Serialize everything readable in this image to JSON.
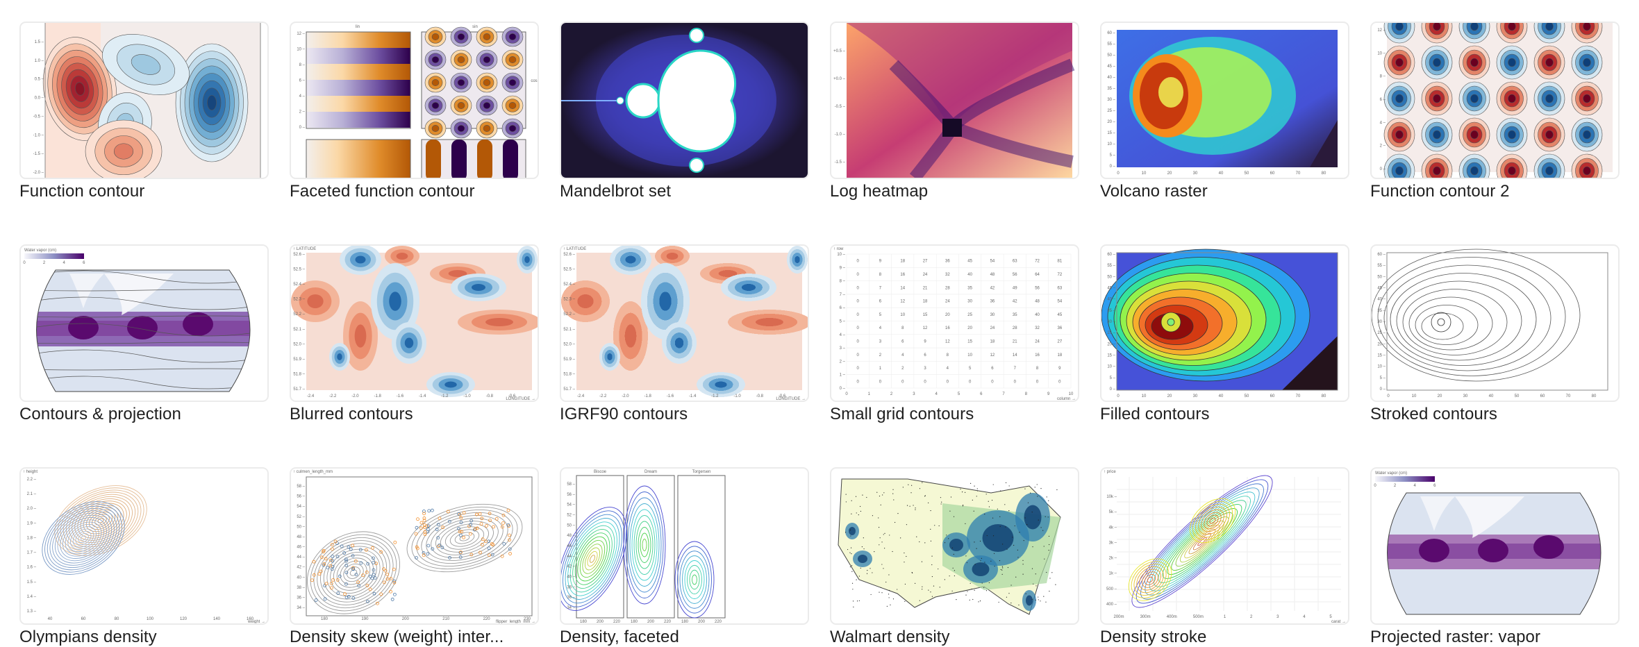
{
  "gallery": {
    "items": [
      {
        "title": "Function contour",
        "thumb": "function-contour",
        "axis": {
          "y": [
            "1.5",
            "1.0",
            "0.5",
            "0.0",
            "-0.5",
            "-1.0",
            "-1.5",
            "-2.0"
          ]
        }
      },
      {
        "title": "Faceted function contour",
        "thumb": "faceted-function-contour",
        "facets": {
          "columns": [
            "lin",
            "sin"
          ],
          "rows": [
            "cos"
          ]
        },
        "axis": {
          "y": [
            "12",
            "10",
            "8",
            "6",
            "4",
            "2",
            "0"
          ]
        }
      },
      {
        "title": "Mandelbrot set",
        "thumb": "mandelbrot"
      },
      {
        "title": "Log heatmap",
        "thumb": "log-heatmap",
        "axis": {
          "y": [
            "+0.5",
            "+0.0",
            "-0.5",
            "-1.0",
            "-1.5"
          ]
        }
      },
      {
        "title": "Volcano raster",
        "thumb": "volcano-raster",
        "axis": {
          "x": [
            "0",
            "10",
            "20",
            "30",
            "40",
            "50",
            "60",
            "70",
            "80"
          ],
          "y": [
            "60",
            "55",
            "50",
            "45",
            "40",
            "35",
            "30",
            "25",
            "20",
            "15",
            "10",
            "5",
            "0"
          ]
        }
      },
      {
        "title": "Function contour 2",
        "thumb": "function-contour-2",
        "axis": {
          "y": [
            "12",
            "10",
            "8",
            "6",
            "4",
            "2",
            "0"
          ]
        }
      },
      {
        "title": "Contours & projection",
        "thumb": "contours-projection",
        "legend": {
          "label": "Water vapor (cm)",
          "ticks": [
            "0",
            "2",
            "4",
            "6"
          ]
        }
      },
      {
        "title": "Blurred contours",
        "thumb": "blurred-contours",
        "axis": {
          "xlabel": "LONGITUDE →",
          "ylabel": "↑ LATITUDE",
          "x": [
            "-2.4",
            "-2.2",
            "-2.0",
            "-1.8",
            "-1.6",
            "-1.4",
            "-1.2",
            "-1.0",
            "-0.8",
            "-0.6"
          ],
          "y": [
            "52.6",
            "52.5",
            "52.4",
            "52.3",
            "52.2",
            "52.1",
            "52.0",
            "51.9",
            "51.8",
            "51.7"
          ]
        }
      },
      {
        "title": "IGRF90 contours",
        "thumb": "igrf90-contours",
        "axis": {
          "xlabel": "LONGITUDE →",
          "ylabel": "↑ LATITUDE",
          "x": [
            "-2.4",
            "-2.2",
            "-2.0",
            "-1.8",
            "-1.6",
            "-1.4",
            "-1.2",
            "-1.0",
            "-0.8",
            "-0.6"
          ],
          "y": [
            "52.6",
            "52.5",
            "52.4",
            "52.3",
            "52.2",
            "52.1",
            "52.0",
            "51.9",
            "51.8",
            "51.7"
          ]
        }
      },
      {
        "title": "Small grid contours",
        "thumb": "small-grid-contours",
        "axis": {
          "xlabel": "column →",
          "ylabel": "↑ row",
          "x": [
            "0",
            "1",
            "2",
            "3",
            "4",
            "5",
            "6",
            "7",
            "8",
            "9",
            "10"
          ],
          "y": [
            "0",
            "1",
            "2",
            "3",
            "4",
            "5",
            "6",
            "7",
            "8",
            "9",
            "10"
          ]
        },
        "grid_values": [
          [
            0,
            9,
            18,
            27,
            36,
            45,
            54,
            63,
            72,
            81
          ],
          [
            0,
            8,
            16,
            24,
            32,
            40,
            48,
            56,
            64,
            72
          ],
          [
            0,
            7,
            14,
            21,
            28,
            35,
            42,
            49,
            56,
            63
          ],
          [
            0,
            6,
            12,
            18,
            24,
            30,
            36,
            42,
            48,
            54
          ],
          [
            0,
            5,
            10,
            15,
            20,
            25,
            30,
            35,
            40,
            45
          ],
          [
            0,
            4,
            8,
            12,
            16,
            20,
            24,
            28,
            32,
            36
          ],
          [
            0,
            3,
            6,
            9,
            12,
            15,
            18,
            21,
            24,
            27
          ],
          [
            0,
            2,
            4,
            6,
            8,
            10,
            12,
            14,
            16,
            18
          ],
          [
            0,
            1,
            2,
            3,
            4,
            5,
            6,
            7,
            8,
            9
          ],
          [
            0,
            0,
            0,
            0,
            0,
            0,
            0,
            0,
            0,
            0
          ]
        ]
      },
      {
        "title": "Filled contours",
        "thumb": "filled-contours",
        "axis": {
          "x": [
            "0",
            "10",
            "20",
            "30",
            "40",
            "50",
            "60",
            "70",
            "80"
          ],
          "y": [
            "60",
            "55",
            "50",
            "45",
            "40",
            "35",
            "30",
            "25",
            "20",
            "15",
            "10",
            "5",
            "0"
          ]
        }
      },
      {
        "title": "Stroked contours",
        "thumb": "stroked-contours",
        "axis": {
          "x": [
            "0",
            "10",
            "20",
            "30",
            "40",
            "50",
            "60",
            "70",
            "80"
          ],
          "y": [
            "60",
            "55",
            "50",
            "45",
            "40",
            "35",
            "30",
            "25",
            "20",
            "15",
            "10",
            "5",
            "0"
          ]
        }
      },
      {
        "title": "Olympians density",
        "thumb": "olympians-density",
        "axis": {
          "xlabel": "weight →",
          "ylabel": "↑ height",
          "x": [
            "40",
            "60",
            "80",
            "100",
            "120",
            "140",
            "160"
          ],
          "y": [
            "2.2",
            "2.1",
            "2.0",
            "1.9",
            "1.8",
            "1.7",
            "1.6",
            "1.5",
            "1.4",
            "1.3"
          ]
        }
      },
      {
        "title": "Density skew (weight) inter...",
        "thumb": "density-skew",
        "axis": {
          "xlabel": "flipper_length_mm →",
          "ylabel": "↑ culmen_length_mm",
          "x": [
            "180",
            "190",
            "200",
            "210",
            "220",
            "230"
          ],
          "y": [
            "58",
            "56",
            "54",
            "52",
            "50",
            "48",
            "46",
            "44",
            "42",
            "40",
            "38",
            "36",
            "34"
          ]
        }
      },
      {
        "title": "Density, faceted",
        "thumb": "density-faceted",
        "facets": {
          "columns": [
            "Biscoe",
            "Dream",
            "Torgersen"
          ]
        },
        "axis": {
          "x": [
            "180",
            "200",
            "220"
          ],
          "y": [
            "58",
            "56",
            "54",
            "52",
            "50",
            "48",
            "46",
            "44",
            "42",
            "40",
            "38",
            "36",
            "34"
          ]
        }
      },
      {
        "title": "Walmart density",
        "thumb": "walmart-density"
      },
      {
        "title": "Density stroke",
        "thumb": "density-stroke",
        "axis": {
          "xlabel": "carat →",
          "ylabel": "↑ price",
          "x": [
            "200m",
            "300m",
            "400m",
            "500m",
            "1",
            "2",
            "3",
            "4",
            "5"
          ],
          "y": [
            "10k",
            "5k",
            "4k",
            "3k",
            "2k",
            "1k",
            "500",
            "400"
          ]
        }
      },
      {
        "title": "Projected raster: vapor",
        "thumb": "projected-raster-vapor",
        "legend": {
          "label": "Water vapor (cm)",
          "ticks": [
            "0",
            "2",
            "4",
            "6"
          ]
        }
      }
    ]
  }
}
